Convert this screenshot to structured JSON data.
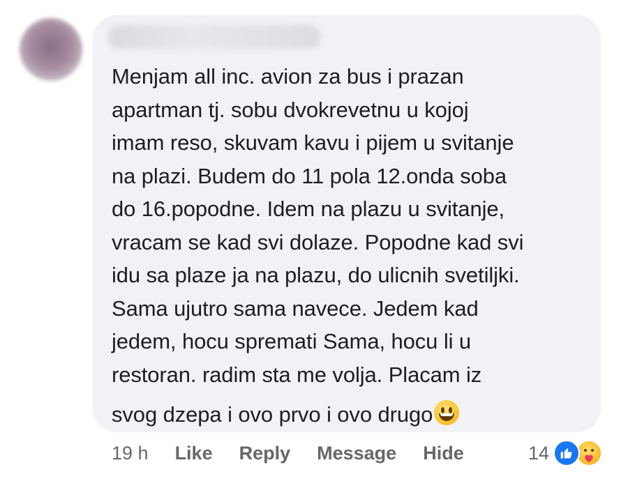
{
  "comment": {
    "author_name": "",
    "lines": [
      "Menjam all inc. avion za bus i prazan",
      "apartman tj. sobu dvokrevetnu u kojoj",
      "imam reso, skuvam kavu i pijem u svitanje",
      "na plazi. Budem do 11 pola 12.onda soba",
      "do 16.popodne. Idem na plazu u svitanje,",
      "vracam se kad svi dolaze. Popodne kad svi",
      "idu sa plaze ja na plazu, do ulicnih svetiljki.",
      "Sama ujutro sama navece. Jedem kad",
      "jedem, hocu spremati Sama, hocu li u",
      "restoran. radim sta me volja. Placam iz",
      "svog dzepa i ovo prvo i ovo drugo"
    ],
    "emoji": "grinning-face-emoji"
  },
  "actions": {
    "time": "19 h",
    "like_label": "Like",
    "reply_label": "Reply",
    "message_label": "Message",
    "hide_label": "Hide"
  },
  "reactions": {
    "count": "14",
    "types": [
      "like-reaction-icon",
      "care-reaction-icon"
    ],
    "like_color": "#1877f2"
  },
  "colors": {
    "bubble_bg": "#f0f2f5",
    "text": "#1c1e21",
    "meta_text": "#65676b"
  }
}
